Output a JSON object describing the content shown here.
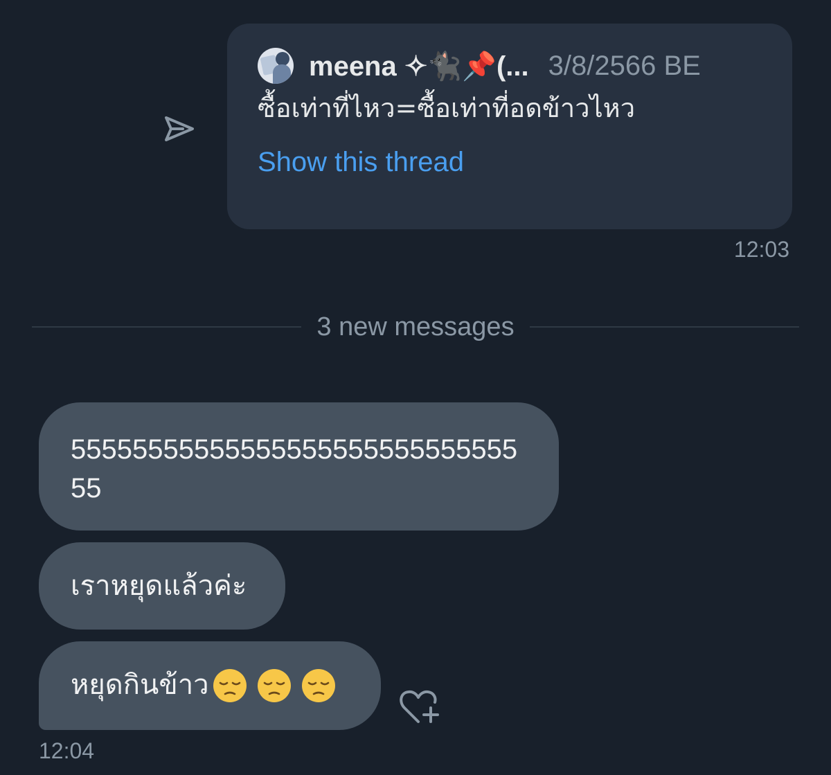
{
  "shared_tweet": {
    "author_name": "meena ✧🐈‍⬛📌(...",
    "date": "3/8/2566 BE",
    "text": "ซื้อเท่าที่ไหว=ซื้อเท่าที่อดข้าวไหว",
    "show_thread_label": "Show this thread",
    "sent_time": "12:03"
  },
  "divider": {
    "label": "3 new messages"
  },
  "messages": [
    {
      "text": "5555555555555555555555555555555"
    },
    {
      "text": "เราหยุดแล้วค่ะ"
    },
    {
      "text": "หยุดกินข้าว",
      "emoji": "pensive-face",
      "emoji_count": 3
    }
  ],
  "received_time": "12:04",
  "icons": {
    "share": "share-arrow-icon",
    "react": "add-reaction-heart-icon"
  },
  "colors": {
    "background": "#18202b",
    "card": "#273140",
    "bubble": "#46525f",
    "link": "#4a9ff0",
    "muted": "#8b98a5"
  }
}
